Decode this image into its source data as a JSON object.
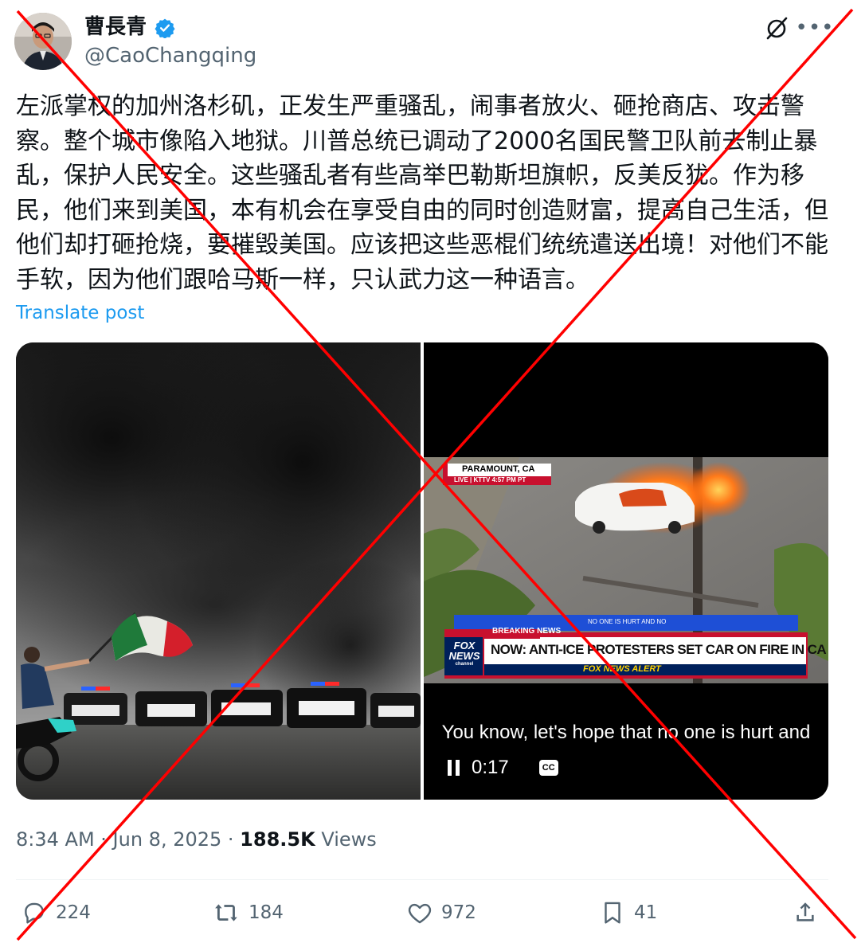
{
  "author": {
    "display_name": "曹長青",
    "handle": "@CaoChangqing",
    "verified": true
  },
  "post": {
    "text": "左派掌权的加州洛杉矶，正发生严重骚乱，闹事者放火、砸抢商店、攻击警察。整个城市像陷入地狱。川普总统已调动了2000名国民警卫队前去制止暴乱，保护人民安全。这些骚乱者有些高举巴勒斯坦旗帜，反美反犹。作为移民，他们来到美国，本有机会在享受自由的同时创造财富，提高自己生活，但他们却打砸抢烧，要摧毁美国。应该把这些恶棍们统统遣送出境！对他们不能手软，因为他们跟哈马斯一样，只认武力这一种语言。",
    "translate_label": "Translate post"
  },
  "media": {
    "video": {
      "location": "PARAMOUNT, CA",
      "live_bar": "LIVE | KTTV 4:57 PM PT",
      "ticker_top": "NO ONE IS HURT AND NO",
      "breaking": "BREAKING NEWS",
      "headline": "NOW: ANTI-ICE PROTESTERS SET CAR ON FIRE IN CA",
      "alert": "FOX NEWS ALERT",
      "logo_fox": "FOX",
      "logo_news": "NEWS",
      "logo_channel": "channel",
      "subtitle": "You know, let's hope that no one is hurt and",
      "time": "0:17",
      "cc_label": "CC"
    }
  },
  "meta": {
    "time": "8:34 AM",
    "date": "Jun 8, 2025",
    "views_count": "188.5K",
    "views_label": "Views"
  },
  "actions": {
    "replies": "224",
    "reposts": "184",
    "likes": "972",
    "bookmarks": "41"
  },
  "colors": {
    "accent": "#1d9bf0",
    "overlay_cross": "#ff0000",
    "secondary_text": "#536471"
  }
}
